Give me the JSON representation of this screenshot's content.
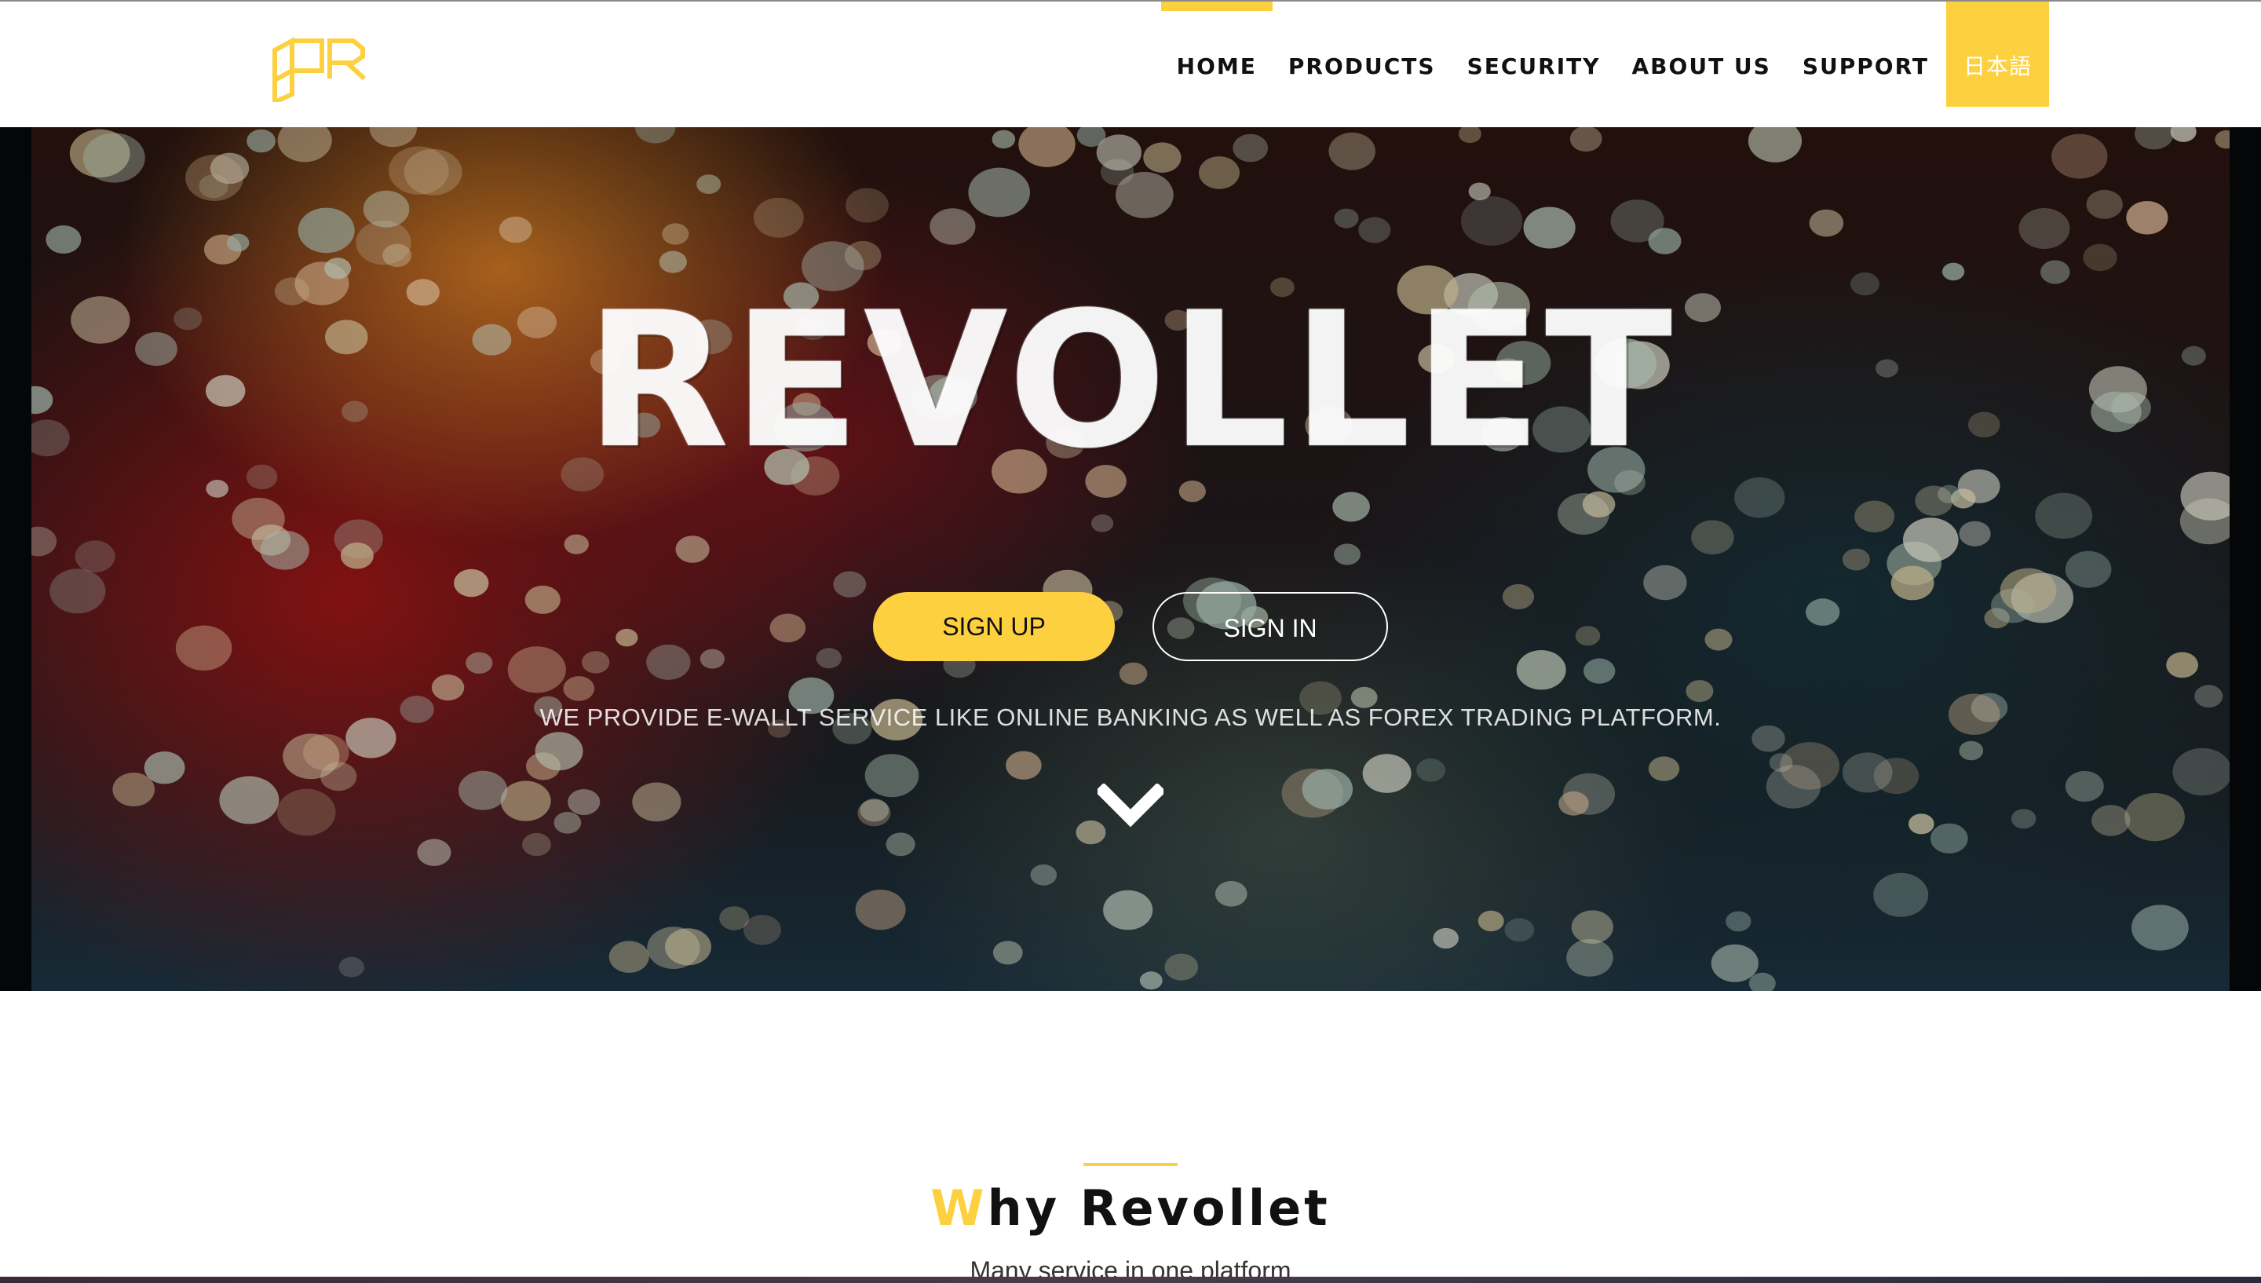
{
  "header": {
    "logo_alt": "Revollet logo",
    "nav": {
      "home": "HOME",
      "products": "PRODUCTS",
      "security": "SECURITY",
      "about": "ABOUT US",
      "support": "SUPPORT",
      "language": "日本語"
    },
    "active_item": "HOME"
  },
  "hero": {
    "title": "REVOLLET",
    "signup_label": "SIGN UP",
    "signin_label": "SIGN IN",
    "tagline": "WE PROVIDE E-WALLT SERVICE LIKE ONLINE BANKING AS WELL AS FOREX TRADING PLATFORM.",
    "scroll_icon": "chevron-down-icon"
  },
  "why": {
    "title_accent": "W",
    "title_rest": "hy Revollet",
    "subtitle": "Many service in one platform"
  },
  "colors": {
    "accent": "#fdd040",
    "text_dark": "#111111",
    "white": "#ffffff"
  }
}
